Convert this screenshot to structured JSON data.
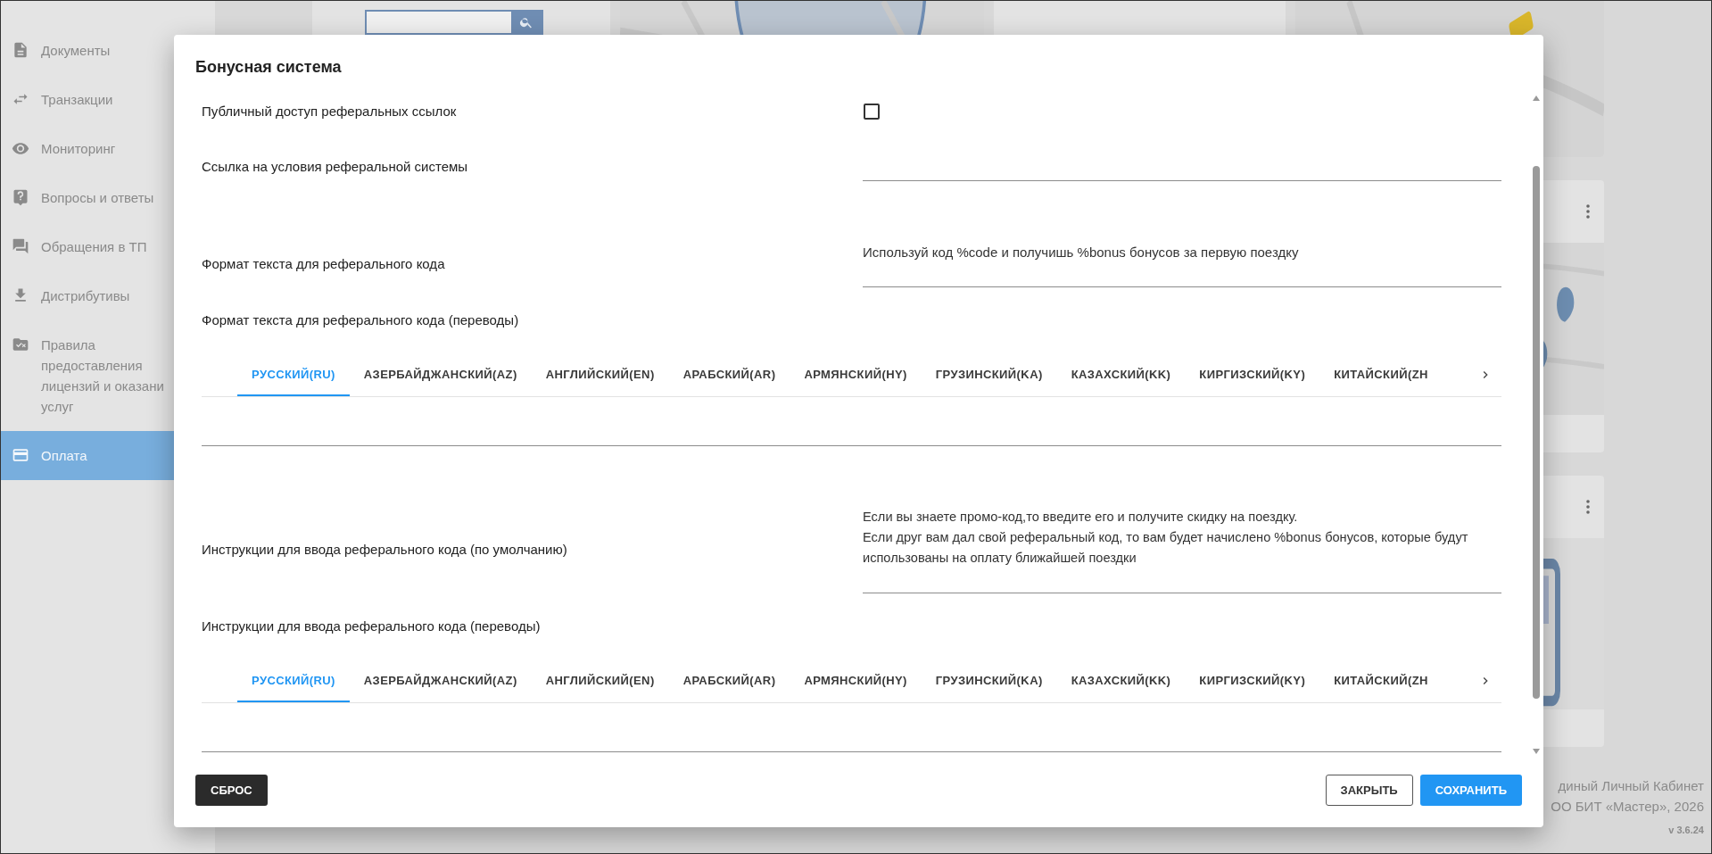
{
  "sidebar": {
    "items": [
      {
        "label": "Документы",
        "selected": false
      },
      {
        "label": "Транзакции",
        "selected": false
      },
      {
        "label": "Мониторинг",
        "selected": false
      },
      {
        "label": "Вопросы и ответы",
        "selected": false
      },
      {
        "label": "Обращения в ТП",
        "selected": false
      },
      {
        "label": "Дистрибутивы",
        "selected": false
      },
      {
        "label": "Правила предоставления лицензий и оказани услуг",
        "selected": false
      },
      {
        "label": "Оплата",
        "selected": true
      }
    ]
  },
  "dialog": {
    "title": "Бонусная система",
    "fields": [
      {
        "kind": "checkbox",
        "label": "Публичный доступ реферальных ссылок",
        "checked": false
      },
      {
        "kind": "text",
        "label": "Ссылка на условия реферальной системы"
      },
      {
        "kind": "text",
        "label": "Формат текста для реферального кода",
        "value": "Используй код %code и получишь %bonus бонусов за первую поездку"
      },
      {
        "kind": "translations",
        "label": "Формат текста для реферального кода (переводы)",
        "tabs": [
          {
            "label": "РУССКИЙ(RU)",
            "selected": true
          },
          {
            "label": "АЗЕРБАЙДЖАНСКИЙ(AZ)",
            "selected": false
          },
          {
            "label": "АНГЛИЙСКИЙ(EN)",
            "selected": false
          },
          {
            "label": "АРАБСКИЙ(AR)",
            "selected": false
          },
          {
            "label": "АРМЯНСКИЙ(HY)",
            "selected": false
          },
          {
            "label": "ГРУЗИНСКИЙ(KA)",
            "selected": false
          },
          {
            "label": "КАЗАХСКИЙ(KK)",
            "selected": false
          },
          {
            "label": "КИРГИЗСКИЙ(KY)",
            "selected": false
          },
          {
            "label": "КИТАЙСКИЙ(ZH",
            "selected": false
          }
        ]
      },
      {
        "kind": "textarea",
        "label": "Инструкции для ввода реферального кода (по умолчанию)",
        "value": "Если вы знаете промо-код,то введите его и получите скидку на поездку.\nЕсли друг вам дал свой реферальный код, то вам будет начислено %bonus бонусов, которые будут использованы на оплату ближайшей поездки"
      },
      {
        "kind": "translations",
        "label": "Инструкции для ввода реферального кода (переводы)",
        "tabs": [
          {
            "label": "РУССКИЙ(RU)",
            "selected": true
          },
          {
            "label": "АЗЕРБАЙДЖАНСКИЙ(AZ)",
            "selected": false
          },
          {
            "label": "АНГЛИЙСКИЙ(EN)",
            "selected": false
          },
          {
            "label": "АРАБСКИЙ(AR)",
            "selected": false
          },
          {
            "label": "АРМЯНСКИЙ(HY)",
            "selected": false
          },
          {
            "label": "ГРУЗИНСКИЙ(KA)",
            "selected": false
          },
          {
            "label": "КАЗАХСКИЙ(KK)",
            "selected": false
          },
          {
            "label": "КИРГИЗСКИЙ(KY)",
            "selected": false
          },
          {
            "label": "КИТАЙСКИЙ(ZH",
            "selected": false
          }
        ]
      }
    ],
    "buttons": [
      {
        "label": "СБРОС",
        "kind": "reset"
      },
      {
        "label": "ЗАКРЫТЬ",
        "kind": "outlined"
      },
      {
        "label": "СОХРАНИТЬ",
        "kind": "primary"
      }
    ]
  },
  "footer": {
    "lines": [
      "диный Личный Кабинет",
      "ОО БИТ «Мастер», 2026"
    ],
    "version": "v 3.6.24"
  }
}
